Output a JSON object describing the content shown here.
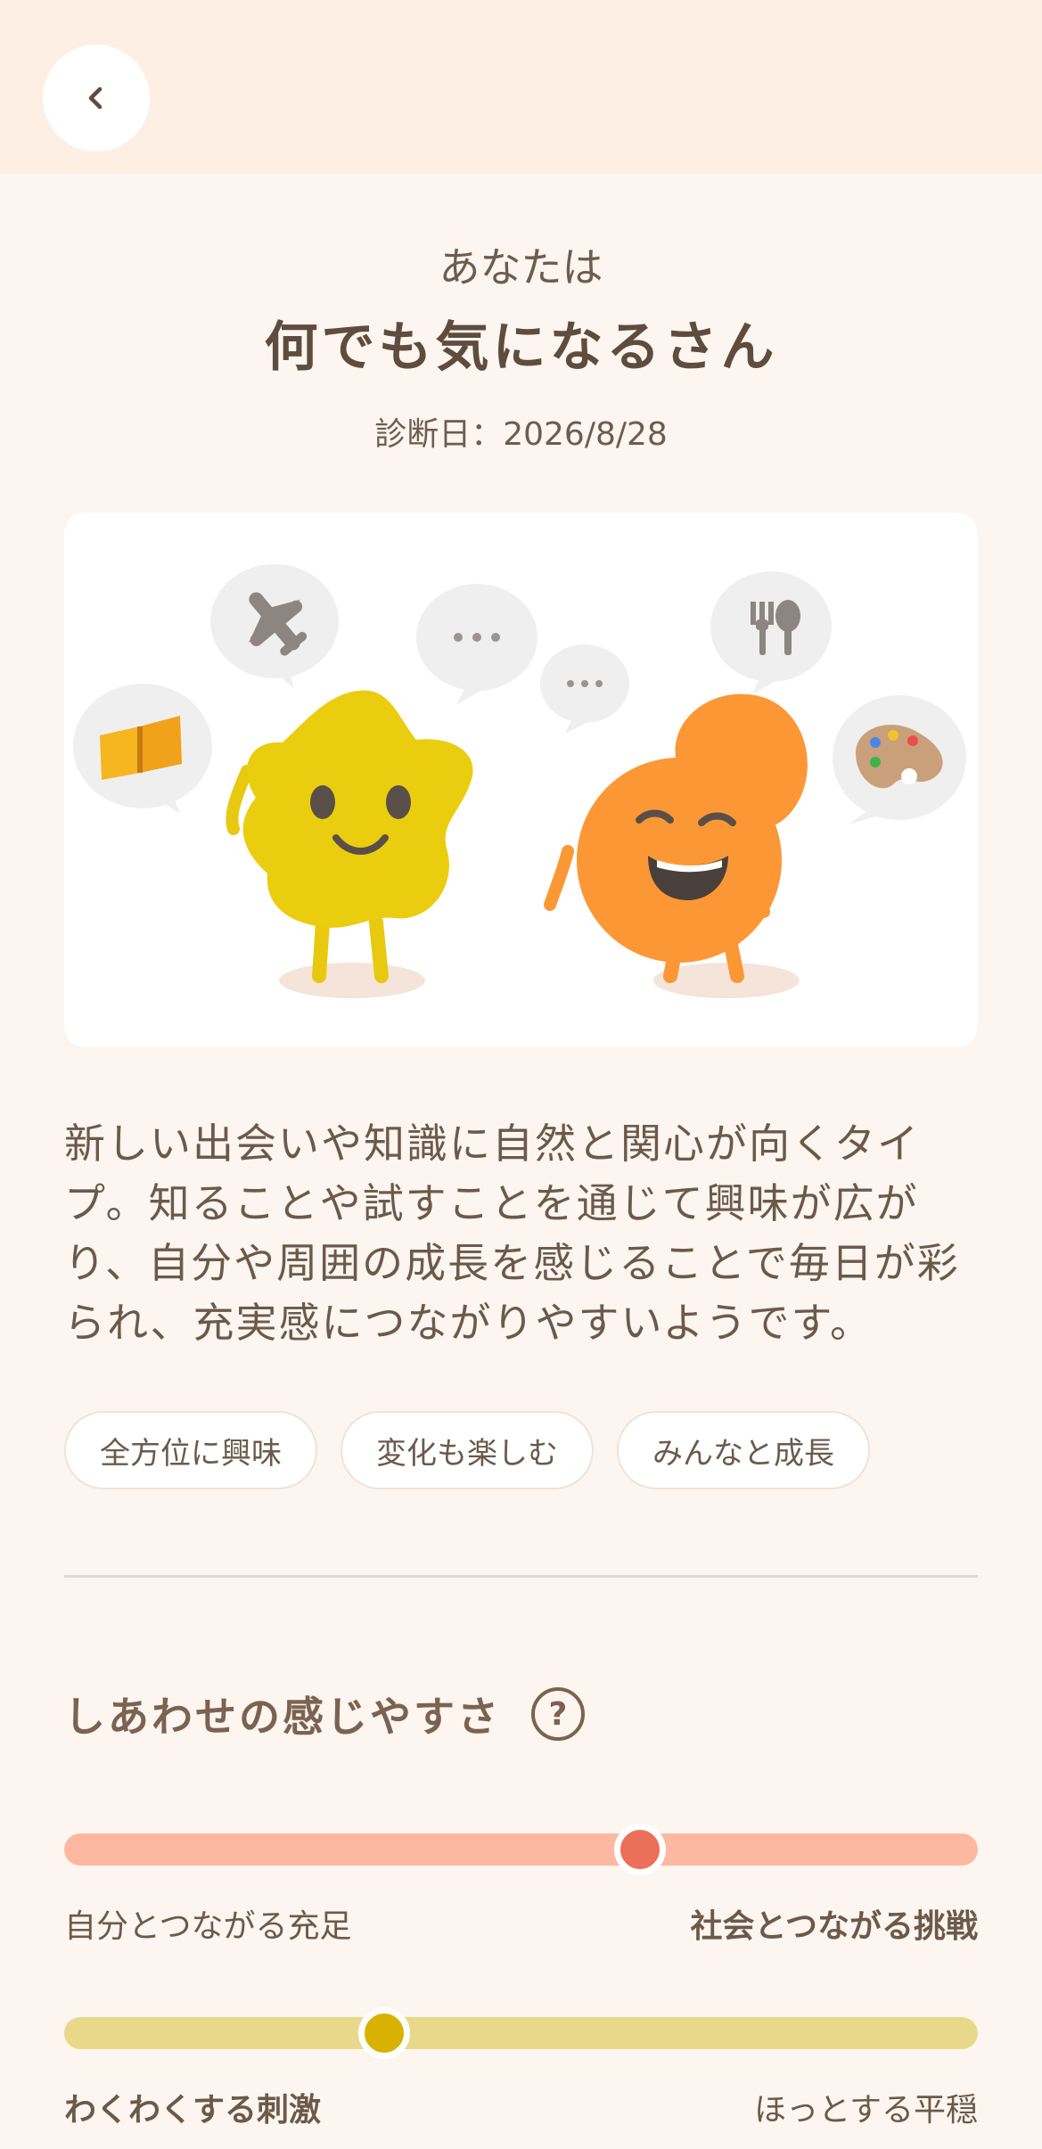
{
  "header": {
    "back_icon": "chevron-left-icon",
    "you_are": "あなたは",
    "type_name": "何でも気になるさん",
    "date_label": "診断日：",
    "date_value": "2026/8/28"
  },
  "illustration": {
    "bubbles": [
      "airplane-icon",
      "speech-dots-icon",
      "fork-spoon-icon",
      "book-icon",
      "palette-icon"
    ]
  },
  "description": "新しい出会いや知識に自然と関心が向くタイプ。知ることや試すことを通じて興味が広がり、自分や周囲の成長を感じることで毎日が彩られ、充実感につながりやすいようです。",
  "tags": [
    "全方位に興味",
    "変化も楽しむ",
    "みんなと成長"
  ],
  "happiness": {
    "title": "しあわせの感じやすさ",
    "help_label": "?",
    "sliders": [
      {
        "left_label": "自分とつながる充足",
        "right_label": "社会とつながる挑戦",
        "emphasis": "right",
        "value": 0.63,
        "track_color": "#fdb8a2",
        "thumb_color": "#ec6f57"
      },
      {
        "left_label": "わくわくする刺激",
        "right_label": "ほっとする平穏",
        "emphasis": "left",
        "value": 0.35,
        "track_color": "#e8d98a",
        "thumb_color": "#d7b200"
      }
    ]
  }
}
